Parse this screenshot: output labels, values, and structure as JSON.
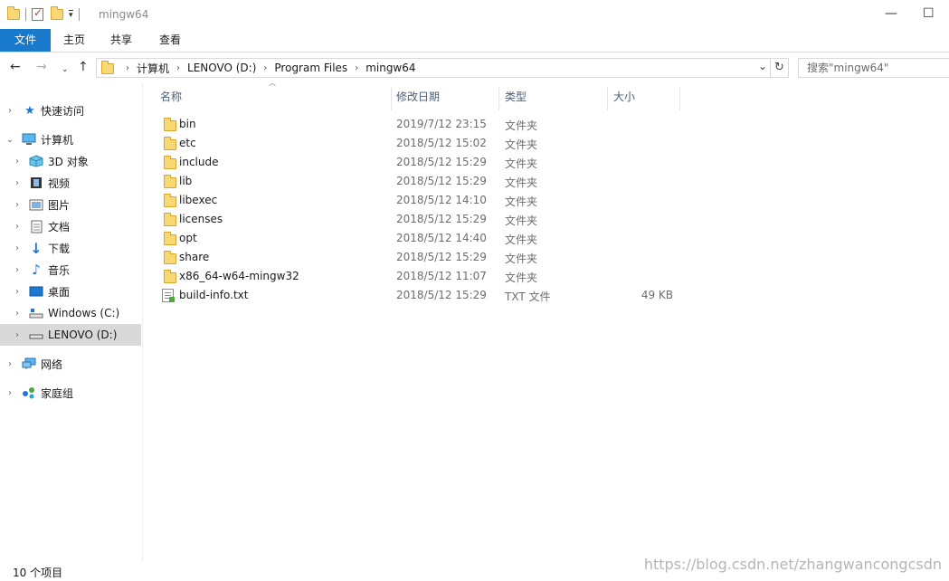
{
  "window": {
    "title": "mingw64",
    "minimize_glyph": "—",
    "maximize_glyph": "☐"
  },
  "ribbon": {
    "tabs": [
      "文件",
      "主页",
      "共享",
      "查看"
    ]
  },
  "address": {
    "crumbs": [
      "计算机",
      "LENOVO (D:)",
      "Program Files",
      "mingw64"
    ],
    "search_placeholder": "搜索\"mingw64\""
  },
  "sidebar": {
    "items": [
      {
        "label": "快速访问",
        "icon": "star-icon"
      },
      {
        "label": "计算机",
        "icon": "computer-icon"
      },
      {
        "label": "3D 对象",
        "icon": "cube-icon"
      },
      {
        "label": "视频",
        "icon": "film-icon"
      },
      {
        "label": "图片",
        "icon": "picture-icon"
      },
      {
        "label": "文档",
        "icon": "document-icon"
      },
      {
        "label": "下载",
        "icon": "download-icon"
      },
      {
        "label": "音乐",
        "icon": "music-icon"
      },
      {
        "label": "桌面",
        "icon": "desktop-icon"
      },
      {
        "label": "Windows (C:)",
        "icon": "drive-c-icon"
      },
      {
        "label": "LENOVO (D:)",
        "icon": "drive-d-icon",
        "selected": true
      },
      {
        "label": "网络",
        "icon": "network-icon"
      },
      {
        "label": "家庭组",
        "icon": "homegroup-icon"
      }
    ]
  },
  "columns": {
    "name": "名称",
    "date": "修改日期",
    "type": "类型",
    "size": "大小"
  },
  "files": [
    {
      "name": "bin",
      "date": "2019/7/12 23:15",
      "type": "文件夹",
      "size": ""
    },
    {
      "name": "etc",
      "date": "2018/5/12 15:02",
      "type": "文件夹",
      "size": ""
    },
    {
      "name": "include",
      "date": "2018/5/12 15:29",
      "type": "文件夹",
      "size": ""
    },
    {
      "name": "lib",
      "date": "2018/5/12 15:29",
      "type": "文件夹",
      "size": ""
    },
    {
      "name": "libexec",
      "date": "2018/5/12 14:10",
      "type": "文件夹",
      "size": ""
    },
    {
      "name": "licenses",
      "date": "2018/5/12 15:29",
      "type": "文件夹",
      "size": ""
    },
    {
      "name": "opt",
      "date": "2018/5/12 14:40",
      "type": "文件夹",
      "size": ""
    },
    {
      "name": "share",
      "date": "2018/5/12 15:29",
      "type": "文件夹",
      "size": ""
    },
    {
      "name": "x86_64-w64-mingw32",
      "date": "2018/5/12 11:07",
      "type": "文件夹",
      "size": ""
    },
    {
      "name": "build-info.txt",
      "date": "2018/5/12 15:29",
      "type": "TXT 文件",
      "size": "49 KB"
    }
  ],
  "status": {
    "item_count": "10 个项目",
    "watermark": "https://blog.csdn.net/zhangwancongcsdn"
  },
  "colors": {
    "file_tab": "#1979ca",
    "folder": "#f8d775",
    "selection": "#d9d9d9"
  }
}
